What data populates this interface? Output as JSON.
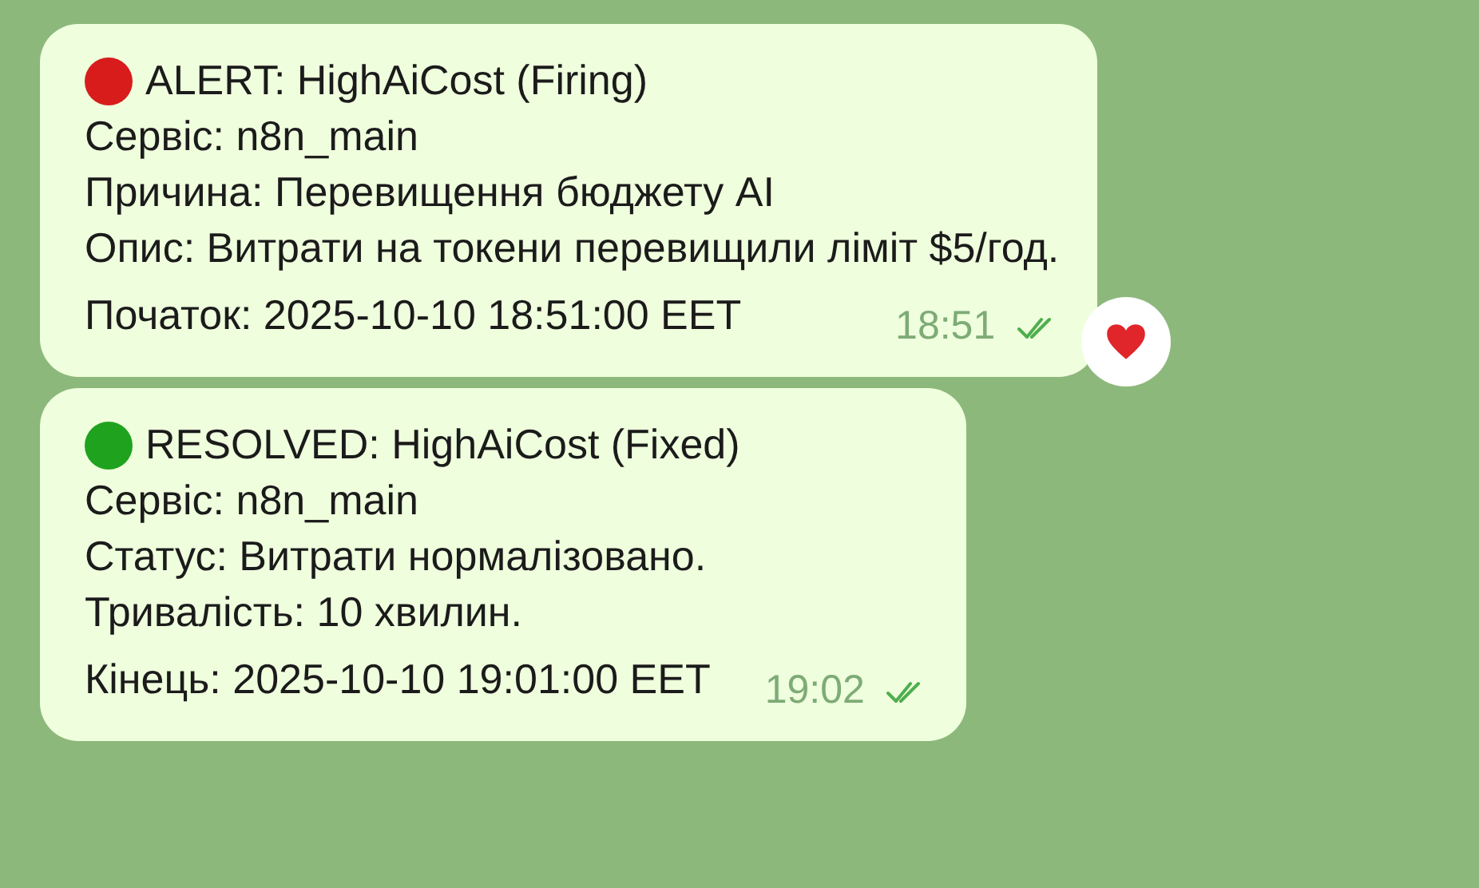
{
  "messages": [
    {
      "color": "#d81c1c",
      "title": "ALERT: HighAiCost (Firing)",
      "lines": [
        "Сервіс: n8n_main",
        "Причина: Перевищення бюджету AI",
        "Опис: Витрати на токени перевищили ліміт $5/год.",
        "Початок: 2025-10-10 18:51:00 EET"
      ],
      "time": "18:51",
      "read": true,
      "reaction": true
    },
    {
      "color": "#1fa31f",
      "title": "RESOLVED: HighAiCost (Fixed)",
      "lines": [
        "Сервіс: n8n_main",
        "Статус: Витрати нормалізовано.",
        "Тривалість: 10 хвилин.",
        "Кінець: 2025-10-10 19:01:00 EET"
      ],
      "time": "19:02",
      "read": true,
      "reaction": false
    }
  ]
}
